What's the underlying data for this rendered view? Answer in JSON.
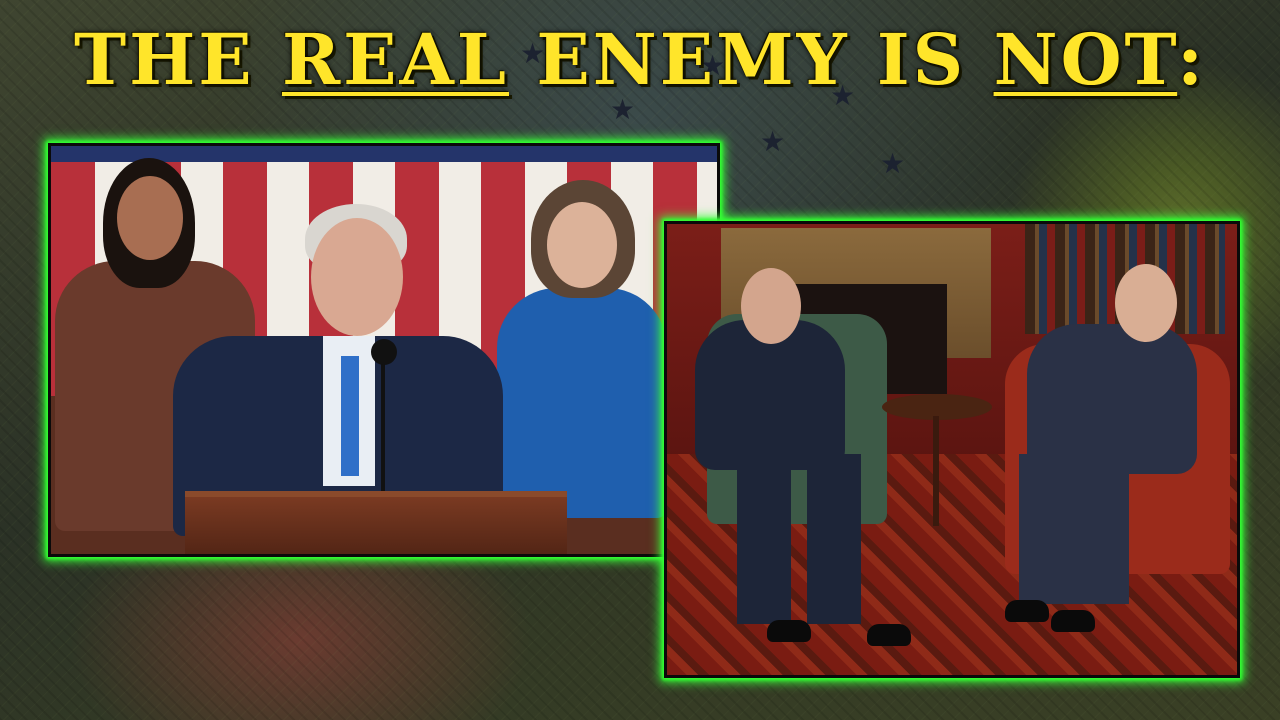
{
  "headline": {
    "prefix": "THE ",
    "underlined_1": "REAL",
    "middle": " ENEMY IS ",
    "underlined_2": "NOT",
    "suffix": ":"
  },
  "colors": {
    "headline": "#ffe52a",
    "frame_glow": "#3aff3a"
  },
  "photos": [
    {
      "scene": "speaker-at-podium-with-flag"
    },
    {
      "scene": "two-men-seated-in-study"
    }
  ]
}
